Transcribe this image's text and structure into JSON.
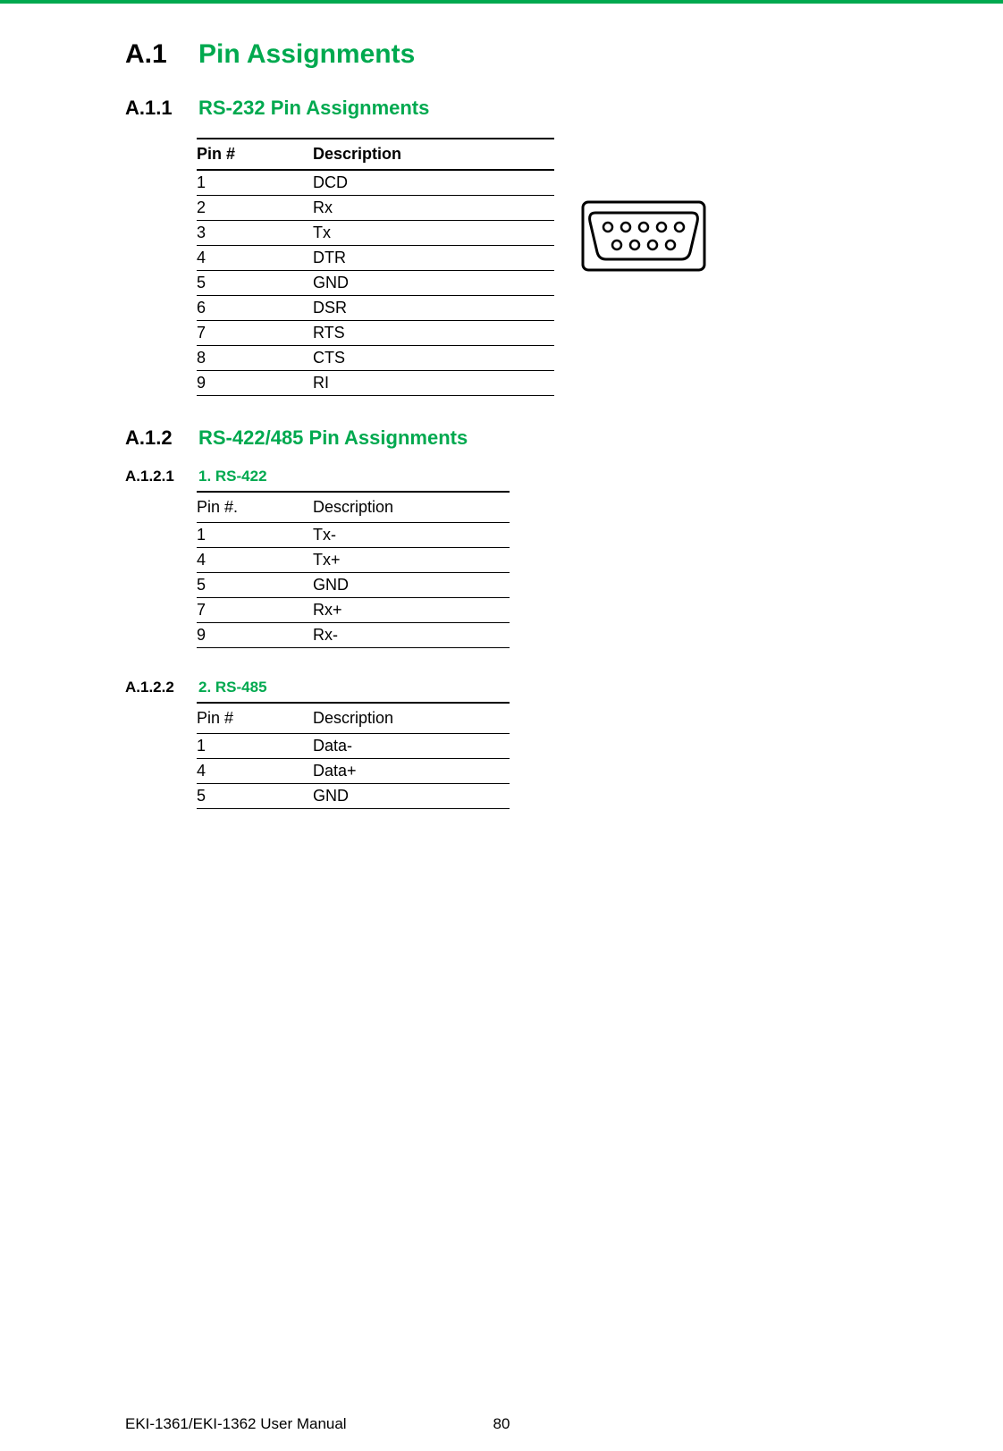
{
  "sections": {
    "a1": {
      "num": "A.1",
      "title": "Pin Assignments"
    },
    "a11": {
      "num": "A.1.1",
      "title": "RS-232 Pin Assignments",
      "table": {
        "headers": [
          "Pin #",
          "Description"
        ],
        "rows": [
          [
            "1",
            "DCD"
          ],
          [
            "2",
            "Rx"
          ],
          [
            "3",
            "Tx"
          ],
          [
            "4",
            "DTR"
          ],
          [
            "5",
            "GND"
          ],
          [
            "6",
            "DSR"
          ],
          [
            "7",
            "RTS"
          ],
          [
            "8",
            "CTS"
          ],
          [
            "9",
            "RI"
          ]
        ]
      }
    },
    "a12": {
      "num": "A.1.2",
      "title": "RS-422/485 Pin Assignments"
    },
    "a121": {
      "num": "A.1.2.1",
      "title": "1. RS-422",
      "table": {
        "headers": [
          "Pin #.",
          "Description"
        ],
        "rows": [
          [
            "1",
            "Tx-"
          ],
          [
            "4",
            "Tx+"
          ],
          [
            "5",
            "GND"
          ],
          [
            "7",
            "Rx+"
          ],
          [
            "9",
            "Rx-"
          ]
        ]
      }
    },
    "a122": {
      "num": "A.1.2.2",
      "title": "2. RS-485",
      "table": {
        "headers": [
          "Pin #",
          "Description"
        ],
        "rows": [
          [
            "1",
            "Data-"
          ],
          [
            "4",
            "Data+"
          ],
          [
            "5",
            "GND"
          ]
        ]
      }
    }
  },
  "footer": {
    "manual": "EKI-1361/EKI-1362 User Manual",
    "page": "80"
  }
}
